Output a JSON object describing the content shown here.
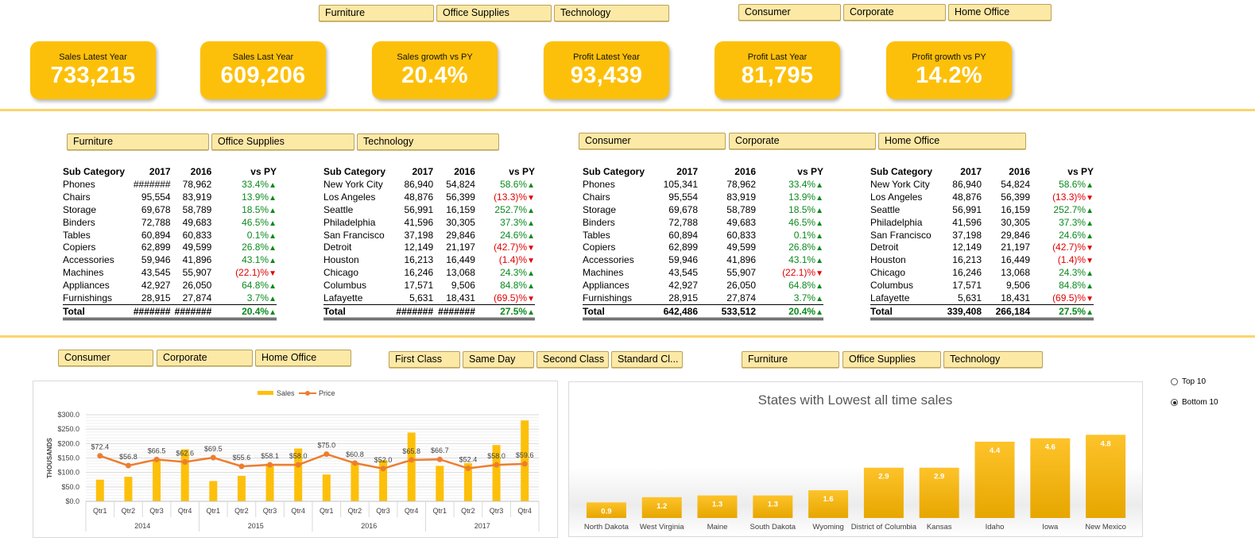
{
  "top_slicers": {
    "category": [
      "Furniture",
      "Office Supplies",
      "Technology"
    ],
    "segment": [
      "Consumer",
      "Corporate",
      "Home Office"
    ]
  },
  "kpis": [
    {
      "title": "Sales Latest Year",
      "value": "733,215"
    },
    {
      "title": "Sales Last Year",
      "value": "609,206"
    },
    {
      "title": "Sales growth vs PY",
      "value": "20.4%"
    },
    {
      "title": "Profit Latest Year",
      "value": "93,439"
    },
    {
      "title": "Profit Last Year",
      "value": "81,795"
    },
    {
      "title": "Profit growth vs PY",
      "value": "14.2%"
    }
  ],
  "mid_slicers": {
    "category": [
      "Furniture",
      "Office Supplies",
      "Technology"
    ],
    "segment": [
      "Consumer",
      "Corporate",
      "Home Office"
    ]
  },
  "tables": {
    "headers": {
      "sub": [
        "Sub Category",
        "2017",
        "2016",
        "vs PY"
      ],
      "city": [
        "Sub Category",
        "2017",
        "2016",
        "vs PY"
      ]
    },
    "t1": {
      "rows": [
        [
          "Phones",
          "#######",
          "78,962",
          "33.4%",
          "up"
        ],
        [
          "Chairs",
          "95,554",
          "83,919",
          "13.9%",
          "up"
        ],
        [
          "Storage",
          "69,678",
          "58,789",
          "18.5%",
          "up"
        ],
        [
          "Binders",
          "72,788",
          "49,683",
          "46.5%",
          "up"
        ],
        [
          "Tables",
          "60,894",
          "60,833",
          "0.1%",
          "up"
        ],
        [
          "Copiers",
          "62,899",
          "49,599",
          "26.8%",
          "up"
        ],
        [
          "Accessories",
          "59,946",
          "41,896",
          "43.1%",
          "up"
        ],
        [
          "Machines",
          "43,545",
          "55,907",
          "(22.1)%",
          "down"
        ],
        [
          "Appliances",
          "42,927",
          "26,050",
          "64.8%",
          "up"
        ],
        [
          "Furnishings",
          "28,915",
          "27,874",
          "3.7%",
          "up"
        ]
      ],
      "total": [
        "Total",
        "#######",
        "#######",
        "20.4%",
        "up"
      ]
    },
    "t2": {
      "rows": [
        [
          "New York City",
          "86,940",
          "54,824",
          "58.6%",
          "up"
        ],
        [
          "Los Angeles",
          "48,876",
          "56,399",
          "(13.3)%",
          "down"
        ],
        [
          "Seattle",
          "56,991",
          "16,159",
          "252.7%",
          "up"
        ],
        [
          "Philadelphia",
          "41,596",
          "30,305",
          "37.3%",
          "up"
        ],
        [
          "San Francisco",
          "37,198",
          "29,846",
          "24.6%",
          "up"
        ],
        [
          "Detroit",
          "12,149",
          "21,197",
          "(42.7)%",
          "down"
        ],
        [
          "Houston",
          "16,213",
          "16,449",
          "(1.4)%",
          "down"
        ],
        [
          "Chicago",
          "16,246",
          "13,068",
          "24.3%",
          "up"
        ],
        [
          "Columbus",
          "17,571",
          "9,506",
          "84.8%",
          "up"
        ],
        [
          "Lafayette",
          "5,631",
          "18,431",
          "(69.5)%",
          "down"
        ]
      ],
      "total": [
        "Total",
        "#######",
        "#######",
        "27.5%",
        "up"
      ]
    },
    "t3": {
      "rows": [
        [
          "Phones",
          "105,341",
          "78,962",
          "33.4%",
          "up"
        ],
        [
          "Chairs",
          "95,554",
          "83,919",
          "13.9%",
          "up"
        ],
        [
          "Storage",
          "69,678",
          "58,789",
          "18.5%",
          "up"
        ],
        [
          "Binders",
          "72,788",
          "49,683",
          "46.5%",
          "up"
        ],
        [
          "Tables",
          "60,894",
          "60,833",
          "0.1%",
          "up"
        ],
        [
          "Copiers",
          "62,899",
          "49,599",
          "26.8%",
          "up"
        ],
        [
          "Accessories",
          "59,946",
          "41,896",
          "43.1%",
          "up"
        ],
        [
          "Machines",
          "43,545",
          "55,907",
          "(22.1)%",
          "down"
        ],
        [
          "Appliances",
          "42,927",
          "26,050",
          "64.8%",
          "up"
        ],
        [
          "Furnishings",
          "28,915",
          "27,874",
          "3.7%",
          "up"
        ]
      ],
      "total": [
        "Total",
        "642,486",
        "533,512",
        "20.4%",
        "up"
      ]
    },
    "t4": {
      "rows": [
        [
          "New York City",
          "86,940",
          "54,824",
          "58.6%",
          "up"
        ],
        [
          "Los Angeles",
          "48,876",
          "56,399",
          "(13.3)%",
          "down"
        ],
        [
          "Seattle",
          "56,991",
          "16,159",
          "252.7%",
          "up"
        ],
        [
          "Philadelphia",
          "41,596",
          "30,305",
          "37.3%",
          "up"
        ],
        [
          "San Francisco",
          "37,198",
          "29,846",
          "24.6%",
          "up"
        ],
        [
          "Detroit",
          "12,149",
          "21,197",
          "(42.7)%",
          "down"
        ],
        [
          "Houston",
          "16,213",
          "16,449",
          "(1.4)%",
          "down"
        ],
        [
          "Chicago",
          "16,246",
          "13,068",
          "24.3%",
          "up"
        ],
        [
          "Columbus",
          "17,571",
          "9,506",
          "84.8%",
          "up"
        ],
        [
          "Lafayette",
          "5,631",
          "18,431",
          "(69.5)%",
          "down"
        ]
      ],
      "total": [
        "Total",
        "339,408",
        "266,184",
        "27.5%",
        "up"
      ]
    }
  },
  "bottom_slicers": {
    "segment": [
      "Consumer",
      "Corporate",
      "Home Office"
    ],
    "ship_mode": [
      "First Class",
      "Same Day",
      "Second Class",
      "Standard Cl..."
    ],
    "category": [
      "Furniture",
      "Office Supplies",
      "Technology"
    ]
  },
  "radio": {
    "options": [
      "Top 10",
      "Bottom 10"
    ],
    "selected": "Bottom 10"
  },
  "colors": {
    "bar": "#fdc00a",
    "line": "#ed7d31",
    "accent_rule": "#fbd46b"
  },
  "chart_data": [
    {
      "type": "bar",
      "title": "",
      "legend": [
        "Sales",
        "Price"
      ],
      "legend_position": "top",
      "ylabel": "THOUSANDS",
      "yticks": [
        "$0.0",
        "$50.0",
        "$100.0",
        "$150.0",
        "$200.0",
        "$250.0",
        "$300.0"
      ],
      "ylim": [
        0,
        300
      ],
      "quarters": [
        "Qtr1",
        "Qtr2",
        "Qtr3",
        "Qtr4",
        "Qtr1",
        "Qtr2",
        "Qtr3",
        "Qtr4",
        "Qtr1",
        "Qtr2",
        "Qtr3",
        "Qtr4",
        "Qtr1",
        "Qtr2",
        "Qtr3",
        "Qtr4"
      ],
      "years": [
        "2014",
        "2015",
        "2016",
        "2017"
      ],
      "series": [
        {
          "name": "Sales",
          "type": "bar",
          "values": [
            75,
            85,
            143,
            180,
            70,
            88,
            130,
            183,
            93,
            135,
            143,
            238,
            123,
            132,
            195,
            280
          ]
        },
        {
          "name": "Price",
          "type": "line",
          "values": [
            72.4,
            56.8,
            66.5,
            62.6,
            69.5,
            55.6,
            58.1,
            58.0,
            75.0,
            60.8,
            52.0,
            65.8,
            66.7,
            52.4,
            58.0,
            59.6
          ],
          "labels": [
            "$72.4",
            "$56.8",
            "$66.5",
            "$62.6",
            "$69.5",
            "$55.6",
            "$58.1",
            "$58.0",
            "$75.0",
            "$60.8",
            "$52.0",
            "$65.8",
            "$66.7",
            "$52.4",
            "$58.0",
            "$59.6"
          ]
        }
      ]
    },
    {
      "type": "bar",
      "title": "States with Lowest all time sales",
      "categories": [
        "North Dakota",
        "West Virginia",
        "Maine",
        "South Dakota",
        "Wyoming",
        "District of Columbia",
        "Kansas",
        "Idaho",
        "Iowa",
        "New Mexico"
      ],
      "values": [
        0.9,
        1.2,
        1.3,
        1.3,
        1.6,
        2.9,
        2.9,
        4.4,
        4.6,
        4.8
      ],
      "labels": [
        "0.9",
        "1.2",
        "1.3",
        "1.3",
        "1.6",
        "2.9",
        "2.9",
        "4.4",
        "4.6",
        "4.8"
      ],
      "ylim": [
        0,
        5.5
      ]
    }
  ]
}
